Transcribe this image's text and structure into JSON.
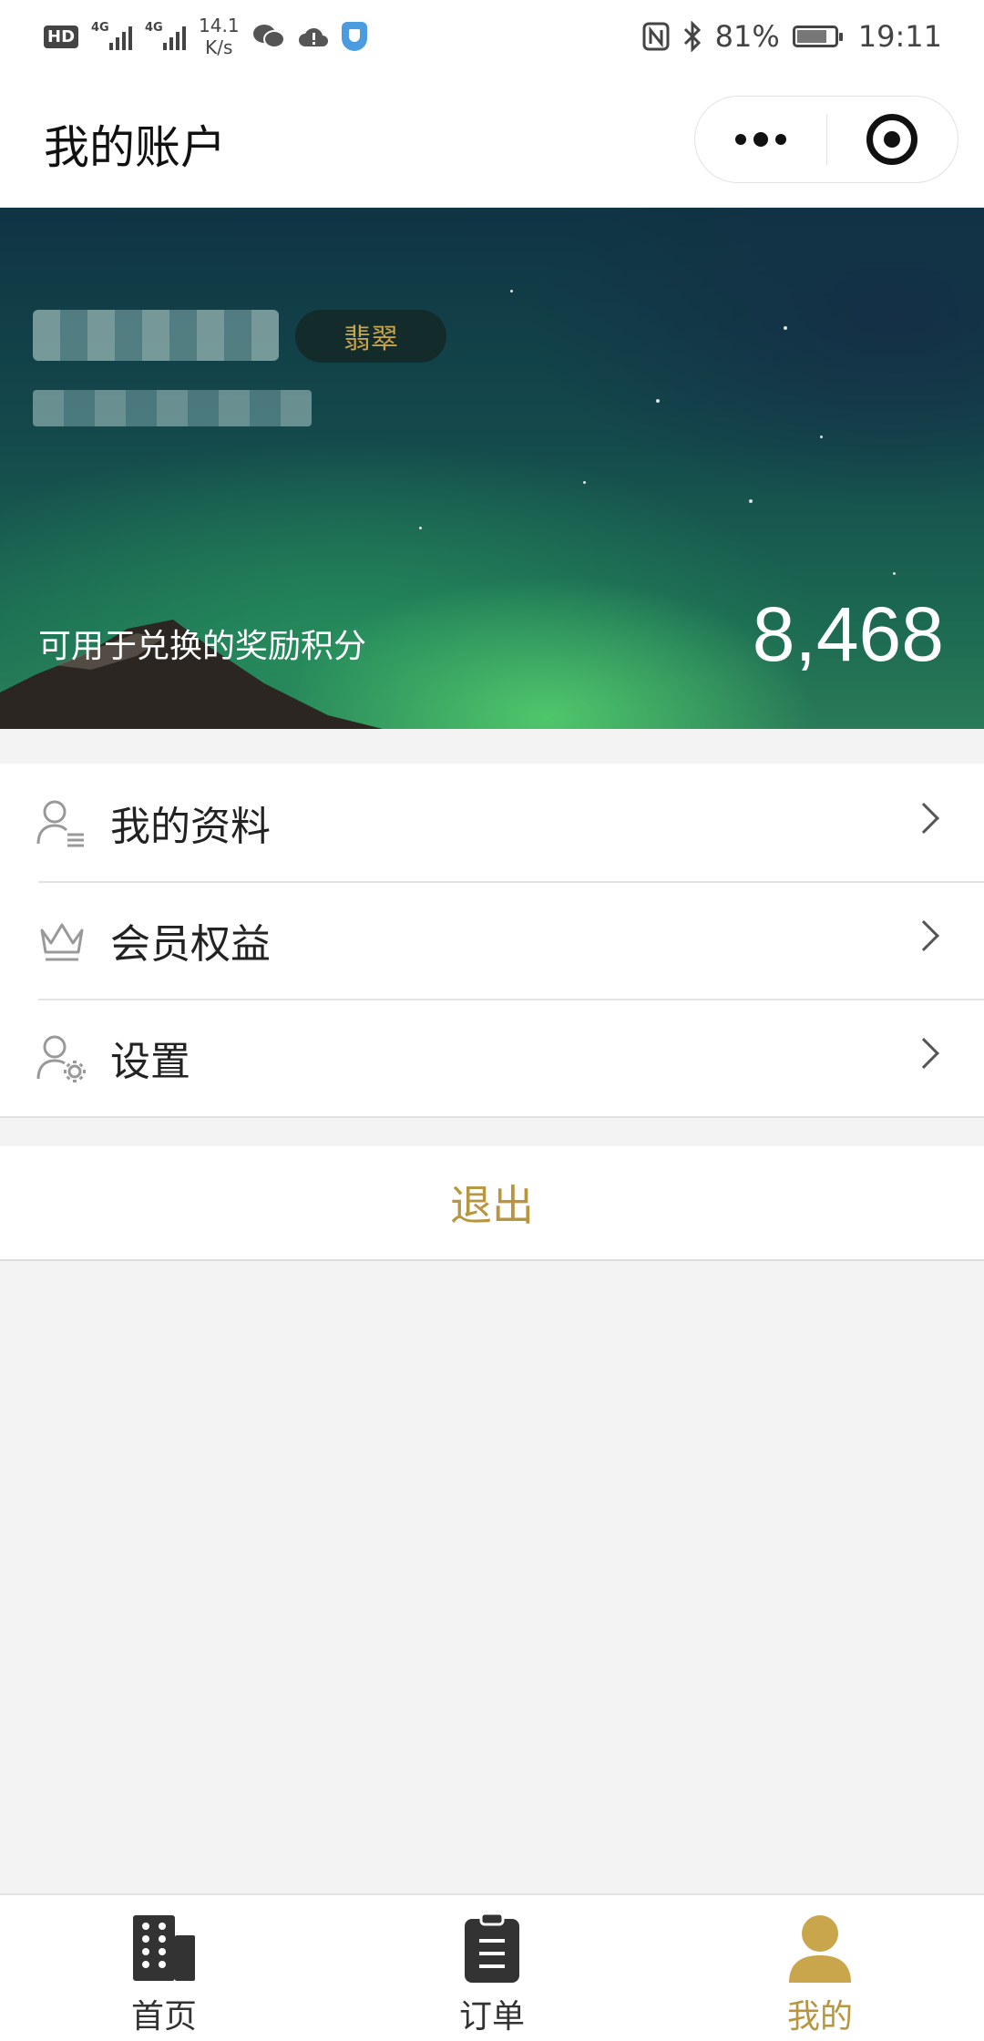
{
  "status_bar": {
    "hd": "HD",
    "signal1": "4G",
    "signal2": "4G",
    "speed_value": "14.1",
    "speed_unit": "K/s",
    "battery_percent": "81%",
    "time": "19:11",
    "icons": [
      "wechat-icon",
      "cloud-icon",
      "shield-icon",
      "nfc-icon",
      "bluetooth-icon",
      "battery-icon"
    ]
  },
  "title_bar": {
    "title": "我的账户",
    "more_icon": "more-dots-icon",
    "close_icon": "target-icon"
  },
  "hero": {
    "tier": "翡翠",
    "points_label": "可用于兑换的奖励积分",
    "points_value": "8,468"
  },
  "menu": {
    "items": [
      {
        "label": "我的资料",
        "icon": "profile-list-icon"
      },
      {
        "label": "会员权益",
        "icon": "crown-icon"
      },
      {
        "label": "设置",
        "icon": "user-settings-icon"
      }
    ]
  },
  "logout": {
    "label": "退出"
  },
  "tabbar": {
    "accent": "#b8953f",
    "tabs": [
      {
        "label": "首页",
        "icon": "building-icon",
        "active": false
      },
      {
        "label": "订单",
        "icon": "clipboard-icon",
        "active": false
      },
      {
        "label": "我的",
        "icon": "user-icon",
        "active": true
      }
    ]
  }
}
